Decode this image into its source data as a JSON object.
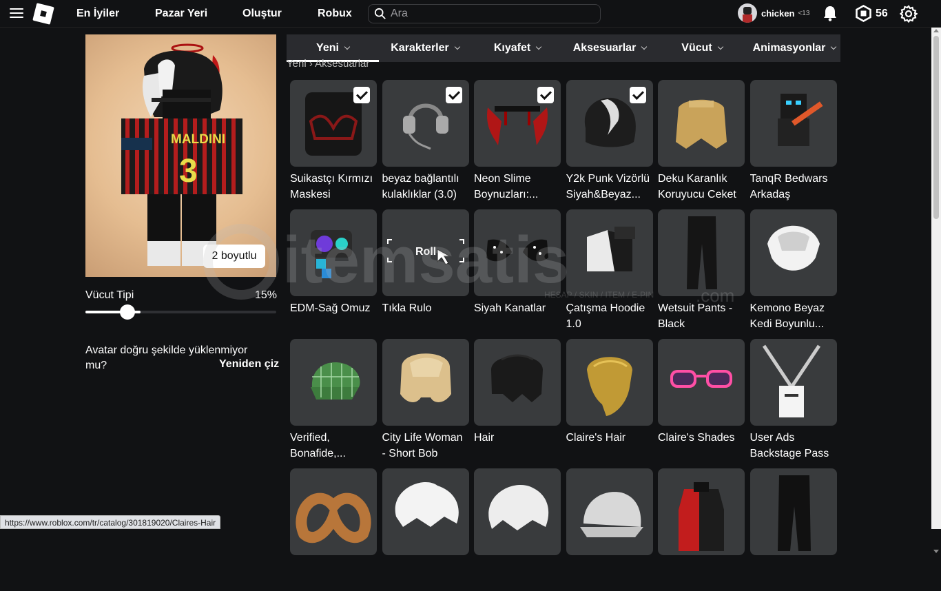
{
  "nav": {
    "links": [
      "En İyiler",
      "Pazar Yeri",
      "Oluştur",
      "Robux"
    ],
    "search_placeholder": "Ara",
    "username": "chicken",
    "age_tag": "<13",
    "robux": "56"
  },
  "avatar": {
    "dimension_badge": "2 boyutlu",
    "body_type_label": "Vücut Tipi",
    "body_type_value": "15%",
    "body_type_fraction": 0.15,
    "not_loading_text": "Avatar doğru şekilde yüklenmiyor mu?",
    "redraw_label": "Yeniden çiz",
    "jersey_name": "MALDINI",
    "jersey_number": "3"
  },
  "tabs": [
    {
      "label": "Yeni",
      "active": true
    },
    {
      "label": "Karakterler",
      "active": false
    },
    {
      "label": "Kıyafet",
      "active": false
    },
    {
      "label": "Aksesuarlar",
      "active": false
    },
    {
      "label": "Vücut",
      "active": false
    },
    {
      "label": "Animasyonlar",
      "active": false
    }
  ],
  "breadcrumb": [
    "Yeni",
    "Aksesuarlar"
  ],
  "items": [
    {
      "name": "Suikastçı Kırmızı Maskesi",
      "icon": "red-mask-icon",
      "equipped": true
    },
    {
      "name": "beyaz bağlantılı kulaklıklar (3.0)",
      "icon": "headphones-icon",
      "equipped": true
    },
    {
      "name": "Neon Slime Boynuzları:...",
      "icon": "red-horns-icon",
      "equipped": true
    },
    {
      "name": "Y2k Punk Vizörlü Siyah&Beyaz...",
      "icon": "punk-hair-icon",
      "equipped": true
    },
    {
      "name": "Deku Karanlık Koruyucu Ceket",
      "icon": "jacket-icon",
      "equipped": false
    },
    {
      "name": "TanqR Bedwars Arkadaş",
      "icon": "figure-sword-icon",
      "equipped": false
    },
    {
      "name": "EDM-Sağ Omuz",
      "icon": "speaker-shoulder-icon",
      "equipped": false
    },
    {
      "name": "Tıkla Rulo",
      "icon": "roll-cursor-icon",
      "equipped": false,
      "overlay_text": "Roll"
    },
    {
      "name": "Siyah Kanatlar",
      "icon": "black-wings-icon",
      "equipped": false
    },
    {
      "name": "Çatışma Hoodie 1.0",
      "icon": "hoodie-icon",
      "equipped": false
    },
    {
      "name": "Wetsuit Pants - Black",
      "icon": "pants-icon",
      "equipped": false
    },
    {
      "name": "Kemono Beyaz Kedi Boyunlu...",
      "icon": "white-neck-icon",
      "equipped": false
    },
    {
      "name": "Verified, Bonafide,...",
      "icon": "green-cap-icon",
      "equipped": false
    },
    {
      "name": "City Life Woman - Short Bob",
      "icon": "blonde-bob-icon",
      "equipped": false
    },
    {
      "name": "Hair",
      "icon": "black-hair-icon",
      "equipped": false
    },
    {
      "name": "Claire's Hair",
      "icon": "gold-hair-icon",
      "equipped": false
    },
    {
      "name": "Claire's Shades",
      "icon": "pink-shades-icon",
      "equipped": false
    },
    {
      "name": "User Ads Backstage Pass",
      "icon": "lanyard-icon",
      "equipped": false
    },
    {
      "name": "",
      "icon": "pretzel-icon",
      "equipped": false
    },
    {
      "name": "",
      "icon": "white-hair-icon",
      "equipped": false
    },
    {
      "name": "",
      "icon": "white-hair-2-icon",
      "equipped": false
    },
    {
      "name": "",
      "icon": "white-cap-icon",
      "equipped": false
    },
    {
      "name": "",
      "icon": "red-suit-icon",
      "equipped": false
    },
    {
      "name": "",
      "icon": "black-pants-icon",
      "equipped": false
    }
  ],
  "watermark": {
    "brand": "itemsatis",
    "sub": "HESAP / SKIN / ITEM / E-PIN",
    "tld": ".com"
  },
  "status_url": "https://www.roblox.com/tr/catalog/301819020/Claires-Hair"
}
